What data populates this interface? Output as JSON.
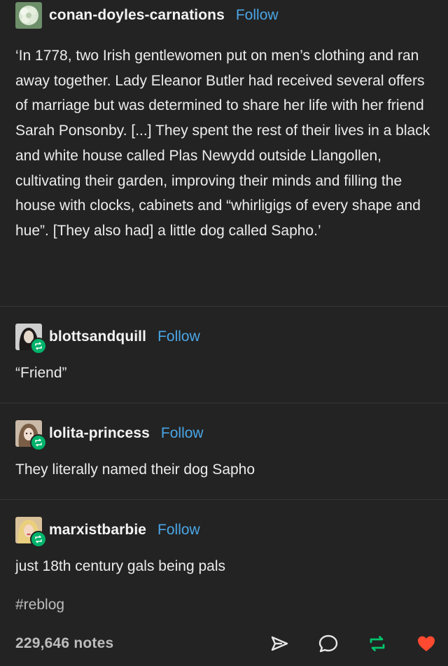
{
  "post": {
    "op": {
      "username": "conan-doyles-carnations",
      "follow_label": "Follow",
      "avatar_icon": "carnation-avatar",
      "text": "‘In 1778, two Irish gentlewomen put on men’s clothing and ran away together.  Lady Eleanor Butler had received several offers of marriage but was determined to share her life with her friend Sarah Ponsonby. [...] They spent the rest of their lives in a black and white house called Plas Newydd outside Llangollen, cultivating their garden, improving their minds and filling the house with clocks, cabinets and “whirligigs of every shape and hue”.  [They also had] a little dog called Sapho.’"
    },
    "reblogs": [
      {
        "username": "blottsandquill",
        "follow_label": "Follow",
        "avatar_icon": "dark-hair-avatar",
        "text": "“Friend”"
      },
      {
        "username": "lolita-princess",
        "follow_label": "Follow",
        "avatar_icon": "light-hair-avatar",
        "text": "They literally named their dog Sapho"
      },
      {
        "username": "marxistbarbie",
        "follow_label": "Follow",
        "avatar_icon": "blonde-hair-avatar",
        "text": "just 18th century gals being pals"
      }
    ],
    "tags": "#reblog",
    "notes": "229,646 notes",
    "colors": {
      "background": "#232323",
      "follow": "#4aa6e6",
      "reblog": "#00b36b",
      "like": "#ff4930",
      "divider": "#353535"
    },
    "icons": {
      "share": "share-icon",
      "reply": "reply-icon",
      "reblog": "reblog-icon",
      "like": "heart-icon"
    }
  }
}
